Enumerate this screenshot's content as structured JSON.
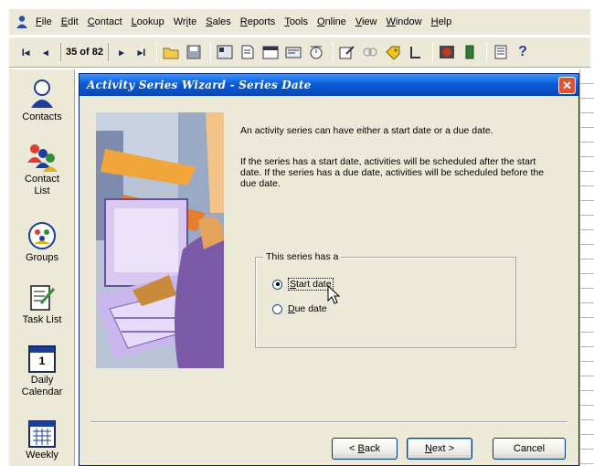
{
  "menu": {
    "items": [
      {
        "u": "F",
        "rest": "ile"
      },
      {
        "u": "E",
        "rest": "dit"
      },
      {
        "u": "C",
        "rest": "ontact"
      },
      {
        "u": "L",
        "rest": "ookup"
      },
      {
        "u": "",
        "pre": "Wr",
        "mid": "i",
        "rest": "te"
      },
      {
        "u": "S",
        "rest": "ales"
      },
      {
        "u": "R",
        "rest": "eports"
      },
      {
        "u": "T",
        "rest": "ools"
      },
      {
        "u": "O",
        "rest": "nline"
      },
      {
        "u": "V",
        "rest": "iew"
      },
      {
        "u": "W",
        "rest": "indow"
      },
      {
        "u": "H",
        "rest": "elp"
      }
    ]
  },
  "toolbar": {
    "first": "I◂",
    "prev": "◂",
    "counter": "35 of 82",
    "next": "▸",
    "last": "▸I",
    "help": "?"
  },
  "nav": {
    "contacts": "Contacts",
    "contact_list_1": "Contact",
    "contact_list_2": "List",
    "groups": "Groups",
    "task_list": "Task List",
    "daily_1": "Daily",
    "daily_2": "Calendar",
    "daily_day": "1",
    "weekly": "Weekly"
  },
  "dialog": {
    "title": "Activity Series Wizard - Series Date",
    "close": "✕",
    "intro": "An activity series can have either a start date or a due date.",
    "detail": "If the series has a start date, activities will be scheduled after the start date. If the series has a due date, activities will be scheduled before the due date.",
    "group_label": "This series has a",
    "options": [
      {
        "u": "S",
        "rest": "tart date",
        "selected": true
      },
      {
        "u": "D",
        "rest": "ue date",
        "selected": false
      }
    ],
    "buttons": {
      "back_pre": "< ",
      "back_u": "B",
      "back_rest": "ack",
      "next_u": "N",
      "next_rest": "ext >",
      "cancel": "Cancel"
    }
  },
  "colors": {
    "title_bar": "#0a5bd8",
    "face": "#ece9d8",
    "close": "#e0532f"
  }
}
